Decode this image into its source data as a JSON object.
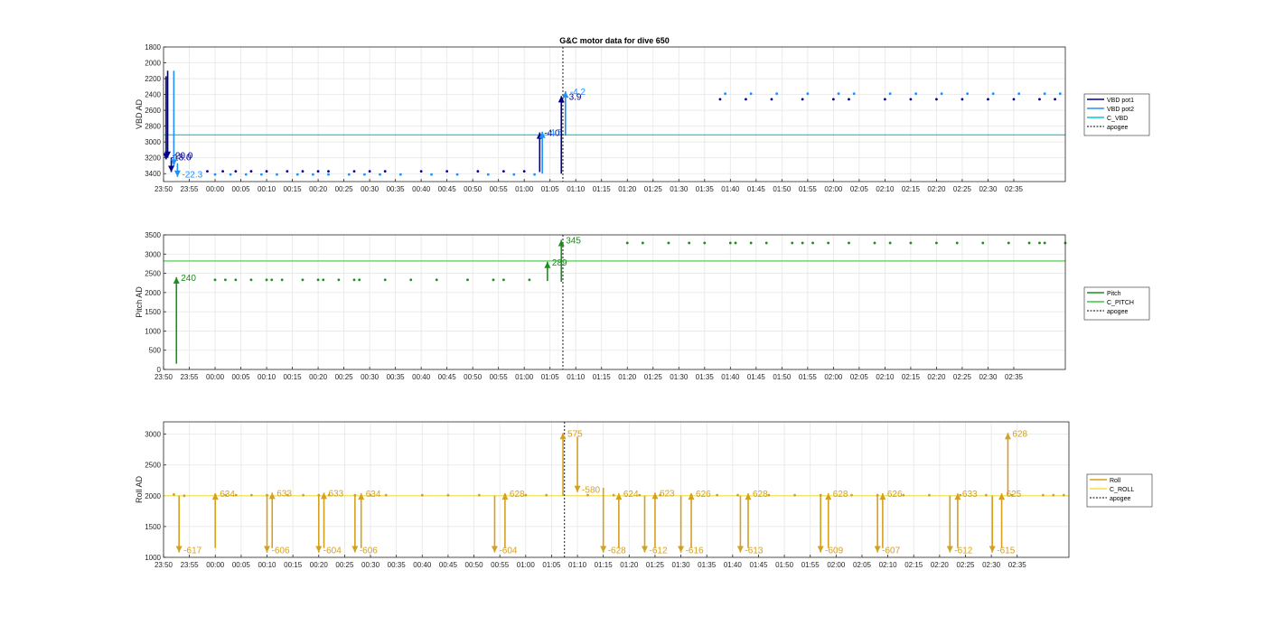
{
  "figure_title": "G&C motor data for dive 650",
  "chart_data": [
    {
      "type": "scatter",
      "ylabel": "VBD AD",
      "ylim": [
        1800,
        3500
      ],
      "y_reversed": true,
      "yticks": [
        1800,
        2000,
        2200,
        2400,
        2600,
        2800,
        3000,
        3200,
        3400
      ],
      "x_range_minutes": [
        -10,
        165
      ],
      "xtick_labels": [
        "23:50",
        "23:55",
        "00:00",
        "00:05",
        "00:10",
        "00:15",
        "00:20",
        "00:25",
        "00:30",
        "00:35",
        "00:40",
        "00:45",
        "00:50",
        "00:55",
        "01:00",
        "01:05",
        "01:10",
        "01:15",
        "01:20",
        "01:25",
        "01:30",
        "01:35",
        "01:40",
        "01:45",
        "01:50",
        "01:55",
        "02:00",
        "02:05",
        "02:10",
        "02:15",
        "02:20",
        "02:25",
        "02:30",
        "02:35"
      ],
      "apogee_minutes": 67.5,
      "grid": true,
      "legend_position": "right",
      "legend": [
        {
          "name": "VBD pot1",
          "color": "#00008b",
          "style": "solid"
        },
        {
          "name": "VBD pot2",
          "color": "#1e90ff",
          "style": "solid"
        },
        {
          "name": "C_VBD",
          "color": "#00c8d8",
          "style": "solid"
        },
        {
          "name": "apogee",
          "color": "#000000",
          "style": "dotted"
        }
      ],
      "hlines": [
        {
          "name": "C_VBD",
          "y": 2910,
          "color": "#00c8d8"
        }
      ],
      "series": [
        {
          "name": "VBD pot1",
          "color": "#00008b",
          "x": [
            -1.5,
            1.5,
            4,
            7,
            10,
            14,
            17,
            20,
            22,
            27,
            30,
            33,
            40,
            45,
            51,
            56,
            60,
            98,
            103,
            108,
            114,
            120,
            123,
            130,
            135,
            140,
            145,
            150,
            155,
            160,
            163,
            167,
            171,
            176,
            180,
            184,
            188,
            191,
            194,
            197,
            201,
            204
          ],
          "y": [
            3370,
            3370,
            3370,
            3370,
            3370,
            3370,
            3370,
            3370,
            3370,
            3370,
            3370,
            3370,
            3370,
            3370,
            3370,
            3370,
            3370,
            2460,
            2460,
            2460,
            2460,
            2460,
            2460,
            2460,
            2460,
            2460,
            2460,
            2460,
            2460,
            2460,
            2460,
            2460,
            2460,
            2460,
            2460,
            2460,
            2460,
            2460,
            2460,
            2460,
            2460,
            2460
          ]
        },
        {
          "name": "VBD pot2",
          "color": "#1e90ff",
          "x": [
            0,
            3,
            6,
            9,
            12,
            16,
            19,
            22,
            26,
            29,
            32,
            36,
            42,
            47,
            53,
            58,
            62,
            99,
            104,
            109,
            115,
            121,
            124,
            131,
            136,
            141,
            146,
            151,
            156,
            161,
            164,
            168,
            172,
            177,
            181,
            185,
            189,
            192,
            195,
            198,
            202,
            205
          ],
          "y": [
            3410,
            3410,
            3410,
            3410,
            3410,
            3410,
            3410,
            3410,
            3410,
            3410,
            3410,
            3410,
            3410,
            3410,
            3410,
            3410,
            3410,
            2390,
            2390,
            2390,
            2390,
            2390,
            2390,
            2390,
            2390,
            2390,
            2390,
            2390,
            2390,
            2390,
            2390,
            2390,
            2390,
            2390,
            2390,
            2390,
            2390,
            2390,
            2390,
            2390,
            2390,
            2390
          ]
        }
      ],
      "arrows": [
        {
          "x": -9.5,
          "y_from": 2170,
          "y_to": 3220,
          "label": "-18.0",
          "color": "#00008b"
        },
        {
          "x": -9.2,
          "y_from": 2100,
          "y_to": 3200,
          "label": "-20.0",
          "color": "#00008b"
        },
        {
          "x": -8.5,
          "y_from": 3200,
          "y_to": 3380,
          "label": "",
          "color": "#00008b"
        },
        {
          "x": -8.0,
          "y_from": 2100,
          "y_to": 3300,
          "label": "",
          "color": "#1e90ff"
        },
        {
          "x": -7.3,
          "y_from": 3270,
          "y_to": 3440,
          "label": "-22.3",
          "color": "#1e90ff"
        },
        {
          "x": 63,
          "y_from": 3380,
          "y_to": 2880,
          "label": "-4.0",
          "color": "#00008b"
        },
        {
          "x": 63.5,
          "y_from": 3400,
          "y_to": 2870,
          "label": "-4.5",
          "color": "#1e90ff"
        },
        {
          "x": 67.2,
          "y_from": 3400,
          "y_to": 2420,
          "label": "-3.9",
          "color": "#00008b"
        },
        {
          "x": 68,
          "y_from": 2920,
          "y_to": 2360,
          "label": "-4.2",
          "color": "#1e90ff"
        }
      ]
    },
    {
      "type": "scatter",
      "ylabel": "Pitch AD",
      "ylim": [
        0,
        3500
      ],
      "y_reversed": false,
      "yticks": [
        0,
        500,
        1000,
        1500,
        2000,
        2500,
        3000,
        3500
      ],
      "x_range_minutes": [
        -10,
        165
      ],
      "xtick_labels": [
        "23:50",
        "23:55",
        "00:00",
        "00:05",
        "00:10",
        "00:15",
        "00:20",
        "00:25",
        "00:30",
        "00:35",
        "00:40",
        "00:45",
        "00:50",
        "00:55",
        "01:00",
        "01:05",
        "01:10",
        "01:15",
        "01:20",
        "01:25",
        "01:30",
        "01:35",
        "01:40",
        "01:45",
        "01:50",
        "01:55",
        "02:00",
        "02:05",
        "02:10",
        "02:15",
        "02:20",
        "02:25",
        "02:30",
        "02:35"
      ],
      "apogee_minutes": 67.5,
      "grid": true,
      "legend_position": "right",
      "legend": [
        {
          "name": "Pitch",
          "color": "#1a8f1a",
          "style": "solid"
        },
        {
          "name": "C_PITCH",
          "color": "#3cc83c",
          "style": "solid"
        },
        {
          "name": "apogee",
          "color": "#000000",
          "style": "dotted"
        }
      ],
      "hlines": [
        {
          "name": "C_PITCH",
          "y": 2820,
          "color": "#3cc83c"
        }
      ],
      "series": [
        {
          "name": "Pitch",
          "color": "#1a8f1a",
          "x": [
            0,
            2,
            4,
            7,
            10,
            11,
            13,
            17,
            20,
            21,
            24,
            27,
            28,
            33,
            38,
            43,
            49,
            54,
            56,
            61,
            80,
            83,
            88,
            92,
            95,
            100,
            101,
            104,
            107,
            112,
            114,
            116,
            119,
            123,
            128,
            131,
            135,
            140,
            144,
            149,
            154,
            158,
            160,
            161,
            165,
            169,
            170,
            173,
            175,
            178,
            181,
            185,
            188,
            191,
            193,
            196,
            199,
            201,
            204,
            206
          ],
          "y": [
            2330,
            2330,
            2330,
            2330,
            2330,
            2330,
            2330,
            2330,
            2330,
            2330,
            2330,
            2330,
            2330,
            2330,
            2330,
            2330,
            2330,
            2330,
            2330,
            2330,
            3290,
            3290,
            3290,
            3290,
            3290,
            3290,
            3290,
            3290,
            3290,
            3290,
            3290,
            3290,
            3290,
            3290,
            3290,
            3290,
            3290,
            3290,
            3290,
            3290,
            3290,
            3290,
            3290,
            3290,
            3290,
            3290,
            3290,
            3290,
            3290,
            3290,
            3290,
            3290,
            3290,
            3290,
            3290,
            3290,
            3290,
            3290,
            3290,
            3290
          ]
        }
      ],
      "arrows": [
        {
          "x": -7.5,
          "y_from": 150,
          "y_to": 2400,
          "label": "240",
          "color": "#1a8f1a"
        },
        {
          "x": 64.5,
          "y_from": 2300,
          "y_to": 2800,
          "label": "289",
          "color": "#1a8f1a"
        },
        {
          "x": 67.2,
          "y_from": 2280,
          "y_to": 3370,
          "label": "345",
          "color": "#1a8f1a"
        }
      ]
    },
    {
      "type": "scatter",
      "ylabel": "Roll AD",
      "ylim": [
        1000,
        3200
      ],
      "y_reversed": false,
      "yticks": [
        1000,
        1500,
        2000,
        2500,
        3000
      ],
      "x_range_minutes": [
        -10,
        165
      ],
      "xtick_labels": [
        "23:50",
        "23:55",
        "00:00",
        "00:05",
        "00:10",
        "00:15",
        "00:20",
        "00:25",
        "00:30",
        "00:35",
        "00:40",
        "00:45",
        "00:50",
        "00:55",
        "01:00",
        "01:05",
        "01:10",
        "01:15",
        "01:20",
        "01:25",
        "01:30",
        "01:35",
        "01:40",
        "01:45",
        "01:50",
        "01:55",
        "02:00",
        "02:05",
        "02:10",
        "02:15",
        "02:20",
        "02:25",
        "02:30",
        "02:35"
      ],
      "apogee_minutes": 67.5,
      "grid": true,
      "legend_position": "right",
      "legend": [
        {
          "name": "Roll",
          "color": "#d4a020",
          "style": "solid"
        },
        {
          "name": "C_ROLL",
          "color": "#f0e040",
          "style": "solid"
        },
        {
          "name": "apogee",
          "color": "#000000",
          "style": "dotted"
        }
      ],
      "hlines": [
        {
          "name": "C_ROLL",
          "y": 2000,
          "color": "#f0e040"
        }
      ],
      "series": [
        {
          "name": "Roll",
          "color": "#d4a020",
          "x": [
            -8,
            -6,
            0,
            2,
            4,
            7,
            10,
            14,
            17,
            20,
            22,
            27,
            30,
            33,
            40,
            45,
            51,
            56,
            60,
            64,
            72,
            77,
            82,
            86,
            92,
            97,
            101,
            107,
            112,
            117,
            123,
            128,
            133,
            138,
            144,
            149,
            154,
            160,
            162,
            164,
            167,
            169,
            170,
            175,
            178,
            183,
            188,
            193,
            198,
            203,
            208
          ],
          "y": [
            2020,
            2000,
            2010,
            2010,
            2010,
            2010,
            2010,
            2010,
            2010,
            2010,
            2010,
            2010,
            2010,
            2010,
            2010,
            2010,
            2010,
            2010,
            2010,
            2010,
            2010,
            2010,
            2010,
            2010,
            2010,
            2010,
            2010,
            2010,
            2010,
            2010,
            2010,
            2010,
            2010,
            2010,
            2010,
            2010,
            2010,
            2010,
            2010,
            2010,
            2010,
            2010,
            2010,
            2010,
            2010,
            2010,
            2010,
            2010,
            2010,
            2010,
            2010
          ]
        }
      ],
      "arrows": [
        {
          "x": -7,
          "y_from": 2000,
          "y_to": 1080,
          "label": "-617",
          "color": "#d4a020"
        },
        {
          "x": 0,
          "y_from": 1150,
          "y_to": 2040,
          "label": "634",
          "color": "#d4a020"
        },
        {
          "x": 10,
          "y_from": 2000,
          "y_to": 1080,
          "label": "-606",
          "color": "#d4a020"
        },
        {
          "x": 11,
          "y_from": 1150,
          "y_to": 2050,
          "label": "633",
          "color": "#d4a020"
        },
        {
          "x": 20,
          "y_from": 2000,
          "y_to": 1080,
          "label": "-604",
          "color": "#d4a020"
        },
        {
          "x": 21,
          "y_from": 1150,
          "y_to": 2050,
          "label": "633",
          "color": "#d4a020"
        },
        {
          "x": 27,
          "y_from": 2000,
          "y_to": 1080,
          "label": "-606",
          "color": "#d4a020"
        },
        {
          "x": 28.2,
          "y_from": 1150,
          "y_to": 2040,
          "label": "634",
          "color": "#d4a020"
        },
        {
          "x": 54,
          "y_from": 2000,
          "y_to": 1080,
          "label": "-604",
          "color": "#d4a020"
        },
        {
          "x": 56,
          "y_from": 1150,
          "y_to": 2040,
          "label": "628",
          "color": "#d4a020"
        },
        {
          "x": 67.2,
          "y_from": 2000,
          "y_to": 3020,
          "label": "575",
          "color": "#d4a020"
        },
        {
          "x": 70,
          "y_from": 2960,
          "y_to": 2060,
          "label": "-580",
          "color": "#d4a020"
        },
        {
          "x": 75,
          "y_from": 2130,
          "y_to": 1080,
          "label": "-628",
          "color": "#d4a020"
        },
        {
          "x": 78,
          "y_from": 1150,
          "y_to": 2040,
          "label": "624",
          "color": "#d4a020"
        },
        {
          "x": 83,
          "y_from": 2000,
          "y_to": 1080,
          "label": "-612",
          "color": "#d4a020"
        },
        {
          "x": 85,
          "y_from": 1150,
          "y_to": 2050,
          "label": "623",
          "color": "#d4a020"
        },
        {
          "x": 90,
          "y_from": 2000,
          "y_to": 1080,
          "label": "-616",
          "color": "#d4a020"
        },
        {
          "x": 92,
          "y_from": 1150,
          "y_to": 2040,
          "label": "626",
          "color": "#d4a020"
        },
        {
          "x": 101.5,
          "y_from": 2000,
          "y_to": 1080,
          "label": "-613",
          "color": "#d4a020"
        },
        {
          "x": 103,
          "y_from": 1150,
          "y_to": 2040,
          "label": "628",
          "color": "#d4a020"
        },
        {
          "x": 117,
          "y_from": 2000,
          "y_to": 1080,
          "label": "-609",
          "color": "#d4a020"
        },
        {
          "x": 118.5,
          "y_from": 1150,
          "y_to": 2040,
          "label": "628",
          "color": "#d4a020"
        },
        {
          "x": 128,
          "y_from": 2000,
          "y_to": 1080,
          "label": "-607",
          "color": "#d4a020"
        },
        {
          "x": 129,
          "y_from": 1150,
          "y_to": 2040,
          "label": "626",
          "color": "#d4a020"
        },
        {
          "x": 142,
          "y_from": 2000,
          "y_to": 1080,
          "label": "-612",
          "color": "#d4a020"
        },
        {
          "x": 143.5,
          "y_from": 1150,
          "y_to": 2040,
          "label": "633",
          "color": "#d4a020"
        },
        {
          "x": 150.2,
          "y_from": 2000,
          "y_to": 1080,
          "label": "-615",
          "color": "#d4a020"
        },
        {
          "x": 152,
          "y_from": 1150,
          "y_to": 2040,
          "label": "625",
          "color": "#d4a020"
        },
        {
          "x": 153.2,
          "y_from": 2000,
          "y_to": 3020,
          "label": "628",
          "color": "#d4a020"
        }
      ]
    }
  ]
}
